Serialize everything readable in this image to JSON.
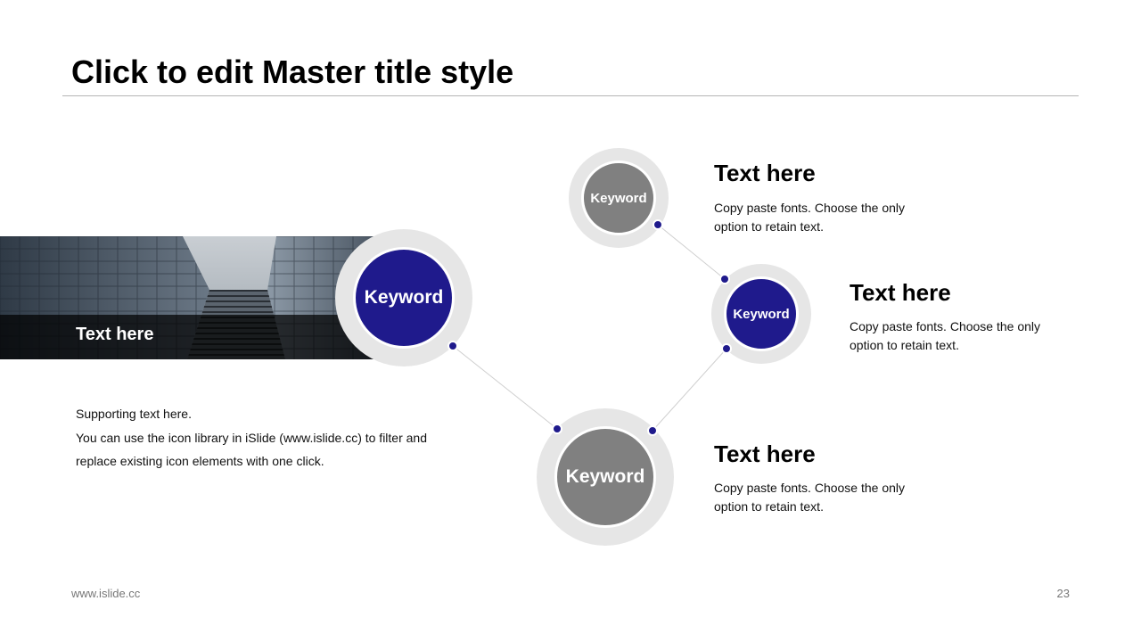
{
  "slide": {
    "title": "Click to edit Master title style",
    "footer_url": "www.islide.cc",
    "page_number": "23"
  },
  "banner": {
    "label": "Text here"
  },
  "nodes": [
    {
      "id": "main",
      "label": "Keyword",
      "color": "#1f1a8c"
    },
    {
      "id": "top",
      "label": "Keyword",
      "color": "#808080"
    },
    {
      "id": "right",
      "label": "Keyword",
      "color": "#1f1a8c"
    },
    {
      "id": "bottom",
      "label": "Keyword",
      "color": "#808080"
    }
  ],
  "blocks": [
    {
      "title": "Text here",
      "body": "Copy paste fonts. Choose the only option to retain text."
    },
    {
      "title": "Text here",
      "body": "Copy paste fonts. Choose the only option to retain text."
    },
    {
      "title": "Text here",
      "body": "Copy paste fonts. Choose the only option to retain text."
    }
  ],
  "support": {
    "lines": [
      "Supporting text here.",
      "You can use the icon library in iSlide  (www.islide.cc)  to filter and",
      "replace existing icon elements with one click."
    ]
  },
  "colors": {
    "accent": "#1f1a8c",
    "neutral": "#808080",
    "ring": "#e6e6e6"
  }
}
